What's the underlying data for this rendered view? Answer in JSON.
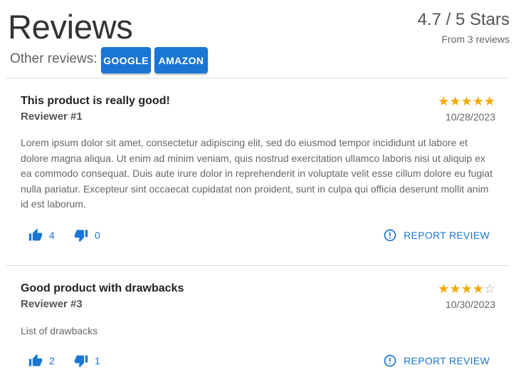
{
  "header": {
    "title": "Reviews",
    "other_reviews_label": "Other reviews:",
    "sources": [
      "GOOGLE",
      "AMAZON"
    ],
    "rating_summary": "4.7 / 5 Stars",
    "review_count": "From 3 reviews"
  },
  "reviews": [
    {
      "title": "This product is really good!",
      "reviewer": "Reviewer #1",
      "stars": 5,
      "date": "10/28/2023",
      "body": "Lorem ipsum dolor sit amet, consectetur adipiscing elit, sed do eiusmod tempor incididunt ut labore et dolore magna aliqua. Ut enim ad minim veniam, quis nostrud exercitation ullamco laboris nisi ut aliquip ex ea commodo consequat. Duis aute irure dolor in reprehenderit in voluptate velit esse cillum dolore eu fugiat nulla pariatur. Excepteur sint occaecat cupidatat non proident, sunt in culpa qui officia deserunt mollit anim id est laborum.",
      "likes": "4",
      "dislikes": "0",
      "report_label": "REPORT REVIEW"
    },
    {
      "title": "Good product with drawbacks",
      "reviewer": "Reviewer #3",
      "stars": 4,
      "date": "10/30/2023",
      "body": "List of drawbacks",
      "likes": "2",
      "dislikes": "1",
      "report_label": "REPORT REVIEW"
    }
  ],
  "colors": {
    "accent": "#1976d2",
    "star": "#f6a900",
    "star_empty": "#aaaaaa"
  },
  "icons": {
    "like": "thumb-up-icon",
    "dislike": "thumb-down-icon",
    "report": "alert-circle-icon",
    "star": "star-icon"
  }
}
